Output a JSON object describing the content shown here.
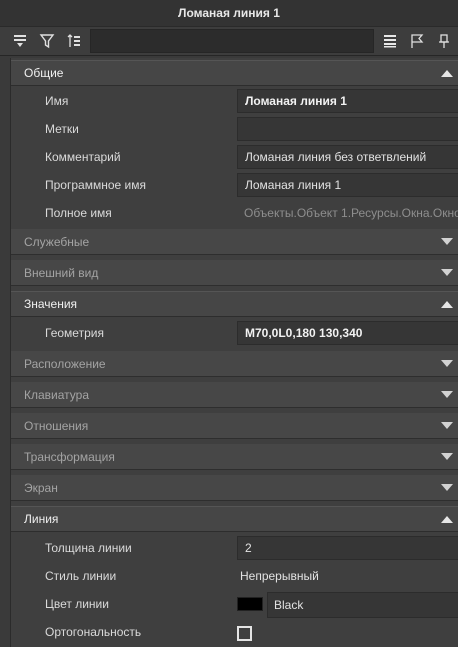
{
  "window": {
    "title": "Ломаная линия 1"
  },
  "toolbar": {
    "icons": [
      "sort-down-icon",
      "filter-icon",
      "sort-tree-icon",
      "list-view-icon",
      "flag-icon",
      "pin-icon"
    ],
    "search_value": ""
  },
  "sections": {
    "general": {
      "label": "Общие",
      "rows": {
        "name": {
          "label": "Имя",
          "value": "Ломаная линия 1"
        },
        "tags": {
          "label": "Метки",
          "value": ""
        },
        "comment": {
          "label": "Комментарий",
          "value": "Ломаная линия без ответвлений"
        },
        "program_name": {
          "label": "Программное имя",
          "value": "Ломаная линия 1"
        },
        "full_name": {
          "label": "Полное имя",
          "value": "Объекты.Объект 1.Ресурсы.Окна.Окно"
        }
      }
    },
    "service": {
      "label": "Служебные"
    },
    "appearance": {
      "label": "Внешний вид"
    },
    "values": {
      "label": "Значения",
      "rows": {
        "geometry": {
          "label": "Геометрия",
          "value": "M70,0L0,180 130,340"
        }
      }
    },
    "location": {
      "label": "Расположение"
    },
    "keyboard": {
      "label": "Клавиатура"
    },
    "relations": {
      "label": "Отношения"
    },
    "transform": {
      "label": "Трансформация"
    },
    "screen": {
      "label": "Экран"
    },
    "line": {
      "label": "Линия",
      "rows": {
        "width": {
          "label": "Толщина линии",
          "value": "2"
        },
        "style": {
          "label": "Стиль линии",
          "value": "Непрерывный"
        },
        "color": {
          "label": "Цвет линии",
          "value": "Black",
          "swatch": "#000000"
        },
        "ortho": {
          "label": "Ортогональность",
          "checked": false
        }
      }
    }
  }
}
